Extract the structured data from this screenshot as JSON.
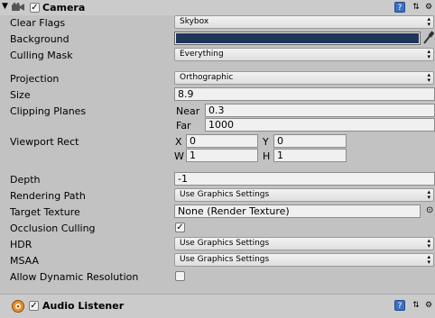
{
  "camera": {
    "title": "Camera",
    "enabled": true,
    "fields": {
      "clear_flags": {
        "label": "Clear Flags",
        "value": "Skybox"
      },
      "background": {
        "label": "Background",
        "color": "#1f3559"
      },
      "culling_mask": {
        "label": "Culling Mask",
        "value": "Everything"
      },
      "projection": {
        "label": "Projection",
        "value": "Orthographic"
      },
      "size": {
        "label": "Size",
        "value": "8.9"
      },
      "clipping_planes": {
        "label": "Clipping Planes",
        "near_label": "Near",
        "near": "0.3",
        "far_label": "Far",
        "far": "1000"
      },
      "viewport_rect": {
        "label": "Viewport Rect",
        "x_label": "X",
        "x": "0",
        "y_label": "Y",
        "y": "0",
        "w_label": "W",
        "w": "1",
        "h_label": "H",
        "h": "1"
      },
      "depth": {
        "label": "Depth",
        "value": "-1"
      },
      "rendering_path": {
        "label": "Rendering Path",
        "value": "Use Graphics Settings"
      },
      "target_texture": {
        "label": "Target Texture",
        "value": "None (Render Texture)"
      },
      "occlusion_culling": {
        "label": "Occlusion Culling",
        "checked": true
      },
      "hdr": {
        "label": "HDR",
        "value": "Use Graphics Settings"
      },
      "msaa": {
        "label": "MSAA",
        "value": "Use Graphics Settings"
      },
      "allow_dynamic_resolution": {
        "label": "Allow Dynamic Resolution",
        "checked": false
      }
    }
  },
  "audio_listener": {
    "title": "Audio Listener",
    "enabled": true
  },
  "icons": {
    "collapse": "▼",
    "camera": "camera-icon",
    "help": "?",
    "preset": "⇅",
    "gear": "⚙",
    "check": "✓",
    "dropdown_arrow": "▴▾",
    "object_picker": "⊙",
    "eyedropper": "eyedropper-icon",
    "audio": "audio-listener-icon"
  }
}
